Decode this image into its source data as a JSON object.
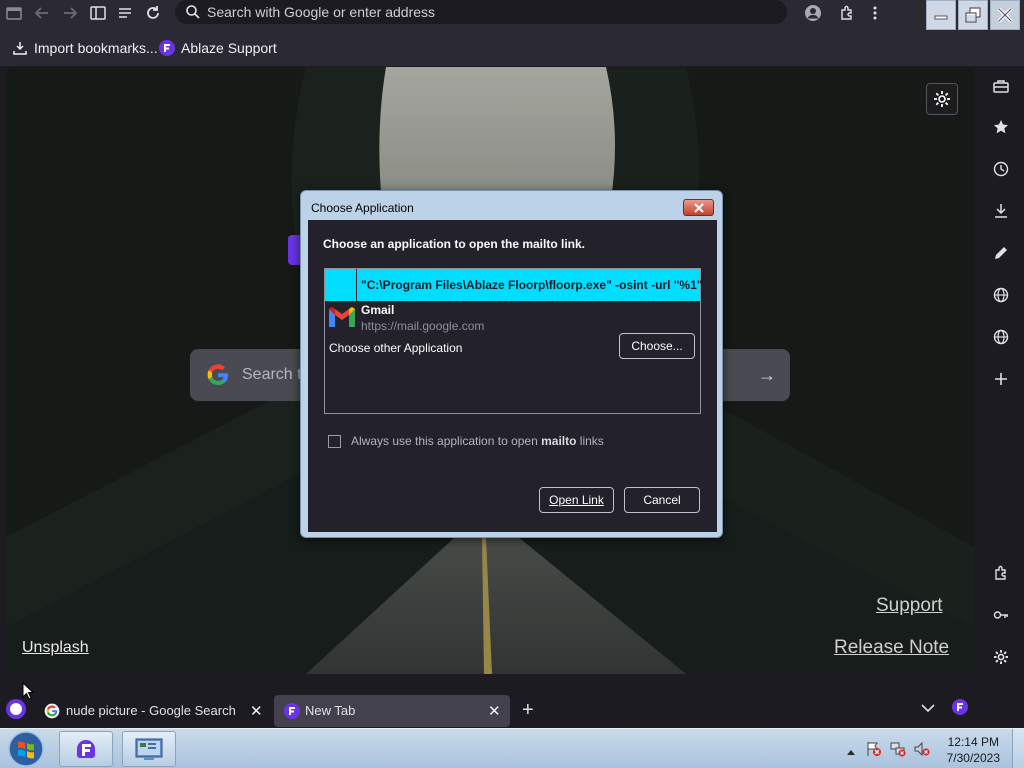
{
  "toolbar": {
    "address_placeholder": "Search with Google or enter address",
    "icons": [
      "sidebar-icon",
      "back-icon",
      "forward-icon",
      "reader-icon",
      "list-icon",
      "reload-icon",
      "search-icon",
      "account-icon",
      "extensions-icon",
      "menu-icon"
    ]
  },
  "bookmarks": {
    "items": [
      {
        "label": "Import bookmarks...",
        "icon": "import-icon"
      },
      {
        "label": "Ablaze Support",
        "icon": "floorp-icon"
      }
    ]
  },
  "newtab": {
    "search_placeholder": "Search the web",
    "links": {
      "unsplash": "Unsplash",
      "support": "Support",
      "release_note": "Release Note"
    }
  },
  "sidebar": {
    "icons": [
      "toolbox-icon",
      "bookmark-star-icon",
      "history-icon",
      "downloads-icon",
      "notes-icon",
      "web-panel-icon",
      "web-panel-icon-2",
      "add-panel-icon",
      "addons-icon",
      "passwords-icon",
      "settings-icon"
    ]
  },
  "dialog": {
    "title": "Choose Application",
    "heading": "Choose an application to open the mailto link.",
    "selected_app": "\"C:\\Program Files\\Ablaze Floorp\\floorp.exe\" -osint -url \"%1\"",
    "gmail_name": "Gmail",
    "gmail_url": "https://mail.google.com",
    "other_label": "Choose other Application",
    "choose_button": "Choose...",
    "checkbox_prefix": "Always use this application to open ",
    "checkbox_bold": "mailto",
    "checkbox_suffix": " links",
    "open_button": "Open Link",
    "cancel_button": "Cancel"
  },
  "tabs": [
    {
      "title": "nude picture - Google Search",
      "active": false
    },
    {
      "title": "New Tab",
      "active": true
    }
  ],
  "taskbar": {
    "time": "12:14 PM",
    "date": "7/30/2023"
  },
  "colors": {
    "accent": "#00ddff",
    "floorp_purple": "#6a34e6",
    "dialog_bg": "#23222b"
  }
}
